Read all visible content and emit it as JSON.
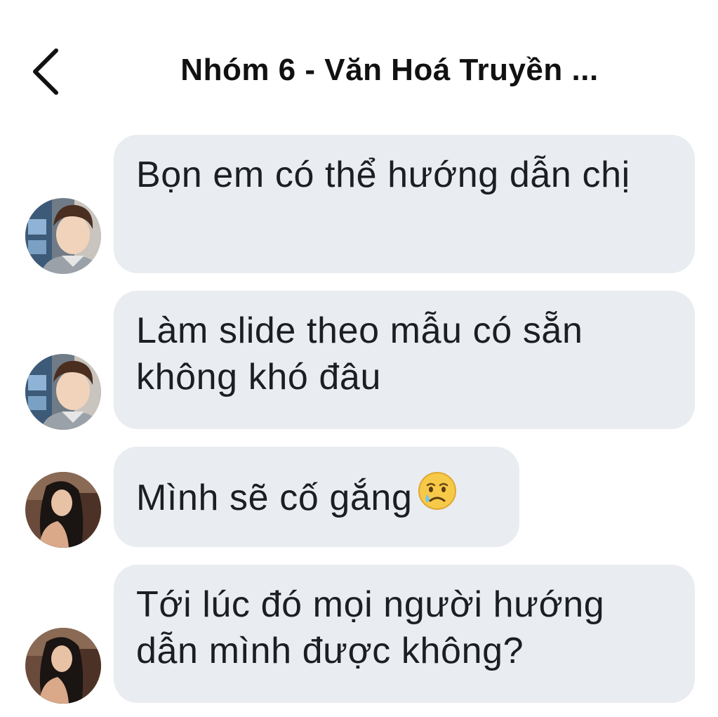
{
  "header": {
    "title": "Nhóm 6 - Văn Hoá Truyền ...",
    "back_icon": "chevron-left-icon"
  },
  "messages": [
    {
      "sender": "male-member",
      "text": "Bọn em có thể hướng dẫn chị",
      "avatar_icon": "male-avatar"
    },
    {
      "sender": "male-member",
      "text": "Làm slide theo mẫu có sẵn không khó đâu",
      "avatar_icon": "male-avatar"
    },
    {
      "sender": "female-member",
      "text": "Mình sẽ cố gắng",
      "emoji": "crying-face-emoji",
      "avatar_icon": "female-avatar"
    },
    {
      "sender": "female-member",
      "text": "Tới lúc đó mọi người hướng dẫn mình được không?",
      "avatar_icon": "female-avatar"
    }
  ],
  "colors": {
    "bubble": "#e9ecf0",
    "text": "#1c1e21",
    "background": "#ffffff"
  }
}
